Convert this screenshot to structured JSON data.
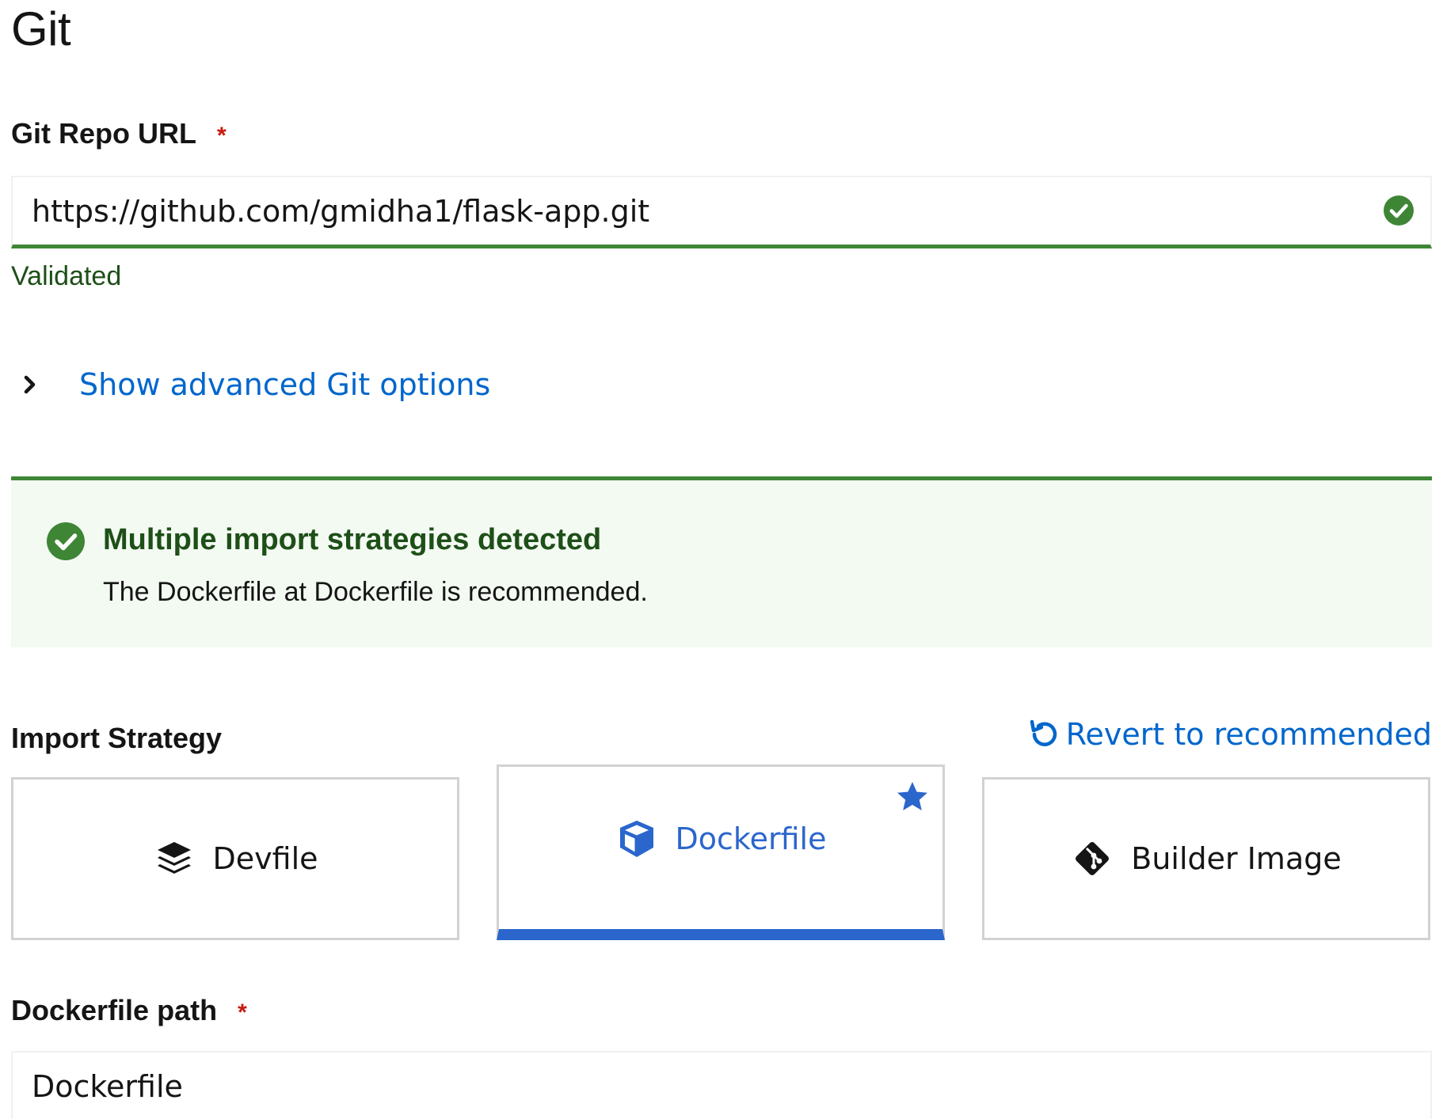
{
  "section": {
    "title": "Git"
  },
  "git_repo": {
    "label": "Git Repo URL",
    "required_marker": "*",
    "value": "https://github.com/gmidha1/flask-app.git",
    "helper_text": "Validated",
    "status_icon": "check-circle-icon"
  },
  "advanced": {
    "label": "Show advanced Git options",
    "icon": "chevron-right-icon"
  },
  "alert": {
    "title": "Multiple import strategies detected",
    "description": "The Dockerfile at Dockerfile is recommended.",
    "variant": "success",
    "icon": "check-circle-icon"
  },
  "import_strategy": {
    "label": "Import Strategy",
    "revert_label": "Revert to recommended",
    "revert_icon": "undo-icon",
    "tiles": [
      {
        "label": "Devfile",
        "icon": "layer-group-icon",
        "selected": false
      },
      {
        "label": "Dockerfile",
        "icon": "cube-icon",
        "selected": true,
        "recommended": true
      },
      {
        "label": "Builder Image",
        "icon": "git-icon",
        "selected": false
      }
    ]
  },
  "dockerfile_path": {
    "label": "Dockerfile path",
    "required_marker": "*",
    "value": "Dockerfile"
  },
  "colors": {
    "success": "#3e8635",
    "success_text": "#1e4f18",
    "link": "#0066cc",
    "selected": "#2b66cc",
    "required": "#c9190b",
    "alert_bg": "#f3faf2"
  }
}
